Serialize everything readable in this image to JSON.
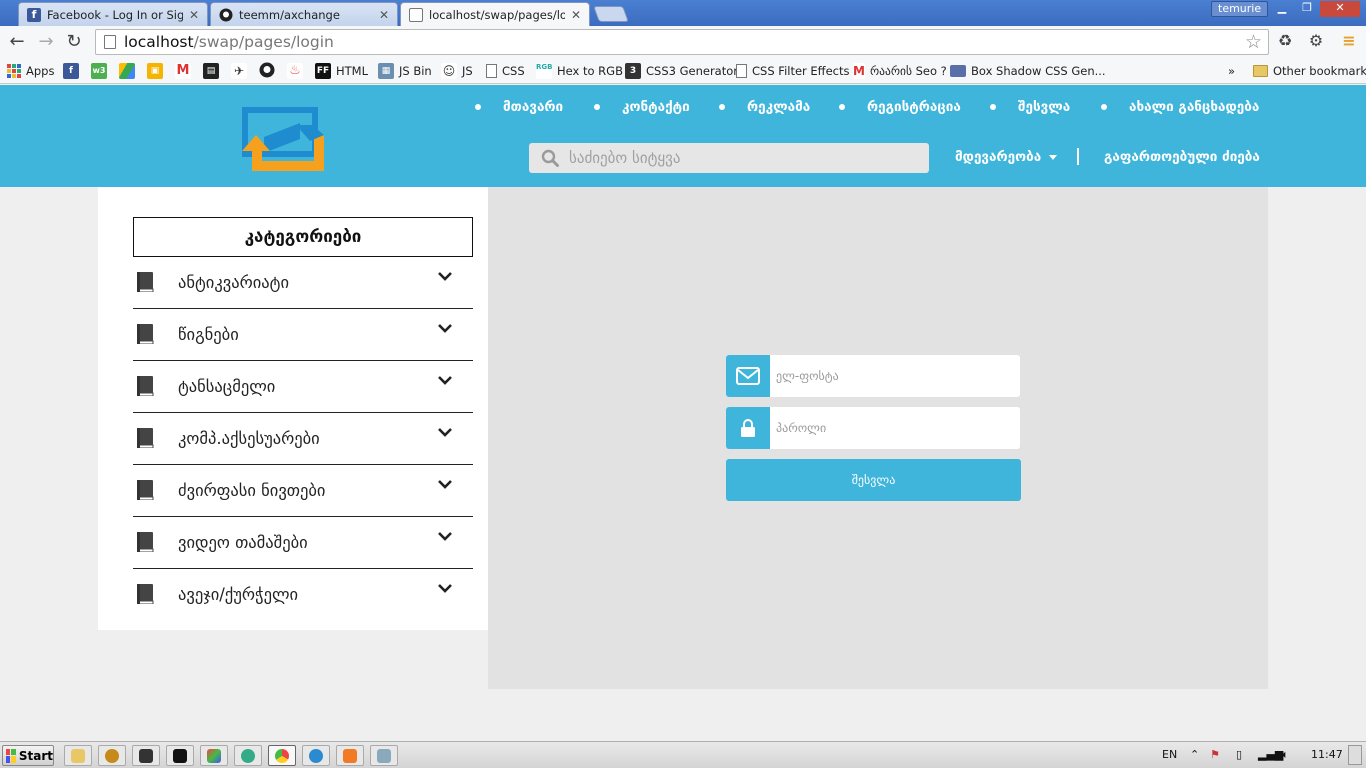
{
  "browser": {
    "tabs": [
      {
        "title": "Facebook - Log In or Sign Up",
        "icon": "facebook-icon",
        "active": false
      },
      {
        "title": "teemm/axchange",
        "icon": "github-icon",
        "active": false
      },
      {
        "title": "localhost/swap/pages/login",
        "icon": "page-icon",
        "active": true
      }
    ],
    "user": "temurie",
    "url_host": "localhost",
    "url_path": "/swap/pages/login",
    "bookmarks": [
      {
        "label": "Apps",
        "icon": "apps-grid-icon"
      },
      {
        "label": "",
        "icon": "facebook-icon"
      },
      {
        "label": "",
        "icon": "w3-icon"
      },
      {
        "label": "",
        "icon": "drive-icon"
      },
      {
        "label": "",
        "icon": "classroom-icon"
      },
      {
        "label": "",
        "icon": "gmail-icon"
      },
      {
        "label": "",
        "icon": "film-icon"
      },
      {
        "label": "",
        "icon": "bird-icon"
      },
      {
        "label": "",
        "icon": "github-icon"
      },
      {
        "label": "",
        "icon": "fire-icon"
      },
      {
        "label": "HTML",
        "icon": "ff-icon"
      },
      {
        "label": "JS Bin",
        "icon": "jsbin-icon"
      },
      {
        "label": "JS",
        "icon": "cat-icon"
      },
      {
        "label": "CSS",
        "icon": "page-icon"
      },
      {
        "label": "Hex to RGB",
        "icon": "rgb-icon"
      },
      {
        "label": "CSS3 Generator",
        "icon": "css3-icon"
      },
      {
        "label": "CSS Filter Effects",
        "icon": "page-icon"
      },
      {
        "label": "რაარის Seo ?",
        "icon": "m-icon"
      },
      {
        "label": "Box Shadow CSS Gen...",
        "icon": "box-icon"
      }
    ],
    "more": "»",
    "other_bookmarks": "Other bookmarks"
  },
  "site": {
    "nav": [
      "მთავარი",
      "კონტაქტი",
      "რეკლამა",
      "რეგისტრაცია",
      "შესვლა",
      "ახალი განცხადება"
    ],
    "search_placeholder": "საძიებო სიტყვა",
    "help_label": "მდევარეობა",
    "advanced_search": "გაფართოებული ძიება"
  },
  "sidebar": {
    "title": "კატეგორიები",
    "items": [
      {
        "label": "ანტიკვარიატი"
      },
      {
        "label": "წიგნები"
      },
      {
        "label": "ტანსაცმელი"
      },
      {
        "label": "კომპ.აქსესუარები"
      },
      {
        "label": "ძვირფასი ნივთები"
      },
      {
        "label": "ვიდეო თამაშები"
      },
      {
        "label": "ავეჯი/ქურჭელი"
      }
    ]
  },
  "login": {
    "email_placeholder": "ელ-ფოსტა",
    "password_placeholder": "პაროლი",
    "submit_label": "შესვლა"
  },
  "taskbar": {
    "start": "Start",
    "lang": "EN",
    "time": "11:47"
  },
  "colors": {
    "brand": "#3fb5dc",
    "logo_blue": "#1f8ccf",
    "logo_orange": "#f5a11d"
  }
}
